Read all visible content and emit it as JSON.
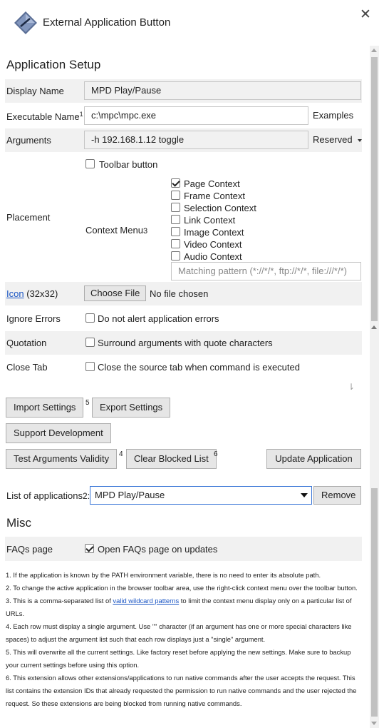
{
  "window": {
    "title": "External Application Button",
    "close_glyph": "✕",
    "logo_icon": "diamond-app-logo"
  },
  "setup": {
    "heading": "Application Setup",
    "display_name": {
      "label": "Display Name",
      "value": "MPD Play/Pause"
    },
    "executable": {
      "label": "Executable Name",
      "sup": "1",
      "value": "c:\\mpc\\mpc.exe",
      "dropdown_label": "Examples"
    },
    "arguments": {
      "label": "Arguments",
      "value": "-h 192.168.1.12 toggle",
      "dropdown_label": "Reserved"
    },
    "placement": {
      "label": "Placement",
      "toolbar_button": {
        "label": "Toolbar button",
        "checked": false
      },
      "context_menu_label": "Context Menu",
      "context_menu_sup": "3",
      "contexts": [
        {
          "label": "Page Context",
          "checked": true
        },
        {
          "label": "Frame Context",
          "checked": false
        },
        {
          "label": "Selection Context",
          "checked": false
        },
        {
          "label": "Link Context",
          "checked": false
        },
        {
          "label": "Image Context",
          "checked": false
        },
        {
          "label": "Video Context",
          "checked": false
        },
        {
          "label": "Audio Context",
          "checked": false
        }
      ],
      "pattern_placeholder": "Matching pattern (*://*/*, ftp://*/*, file:///*/*)"
    },
    "icon": {
      "link_text": "Icon",
      "size_text": "(32x32)",
      "choose_button": "Choose File",
      "file_status": "No file chosen"
    },
    "ignore_errors": {
      "label": "Ignore Errors",
      "option": "Do not alert application errors",
      "checked": false
    },
    "quotation": {
      "label": "Quotation",
      "option": "Surround arguments with quote characters",
      "checked": false
    },
    "close_tab": {
      "label": "Close Tab",
      "option": "Close the source tab when command is executed",
      "checked": false
    }
  },
  "actions": {
    "import": "Import Settings",
    "import_note": "5",
    "export": "Export Settings",
    "support": "Support Development",
    "test": "Test Arguments Validity",
    "test_note": "4",
    "clear": "Clear Blocked List",
    "clear_note": "6",
    "update": "Update Application"
  },
  "app_list": {
    "label": "List of applications",
    "sup": "2",
    "selected": "MPD Play/Pause",
    "remove": "Remove"
  },
  "misc": {
    "heading": "Misc",
    "faqs": {
      "label": "FAQs page",
      "option": "Open FAQs page on updates",
      "checked": true
    }
  },
  "notes": {
    "n1": "1. If the application is known by the PATH environment variable, there is no need to enter its absolute path.",
    "n2": "2. To change the active application in the browser toolbar area, use the right-click context menu over the toolbar button.",
    "n3_pre": "3. This is a comma-separated list of ",
    "n3_link": "valid wildcard patterns",
    "n3_post": " to limit the context menu display only on a particular list of URLs.",
    "n4": "4. Each row must display a single argument. Use \"\" character (if an argument has one or more special characters like spaces) to adjust the argument list such that each row displays just a \"single\" argument.",
    "n5": "5. This will overwrite all the current settings. Like factory reset before applying the new settings. Make sure to backup your current settings before using this option.",
    "n6": "6. This extension allows other extensions/applications to run native commands after the user accepts the request. This list contains the extension IDs that already requested the permission to run native commands and the user rejected the request. So these extensions are being blocked from running native commands."
  },
  "colors": {
    "row_shade": "#f1f1f1",
    "link": "#1a55c4",
    "select_border": "#3875d7"
  }
}
